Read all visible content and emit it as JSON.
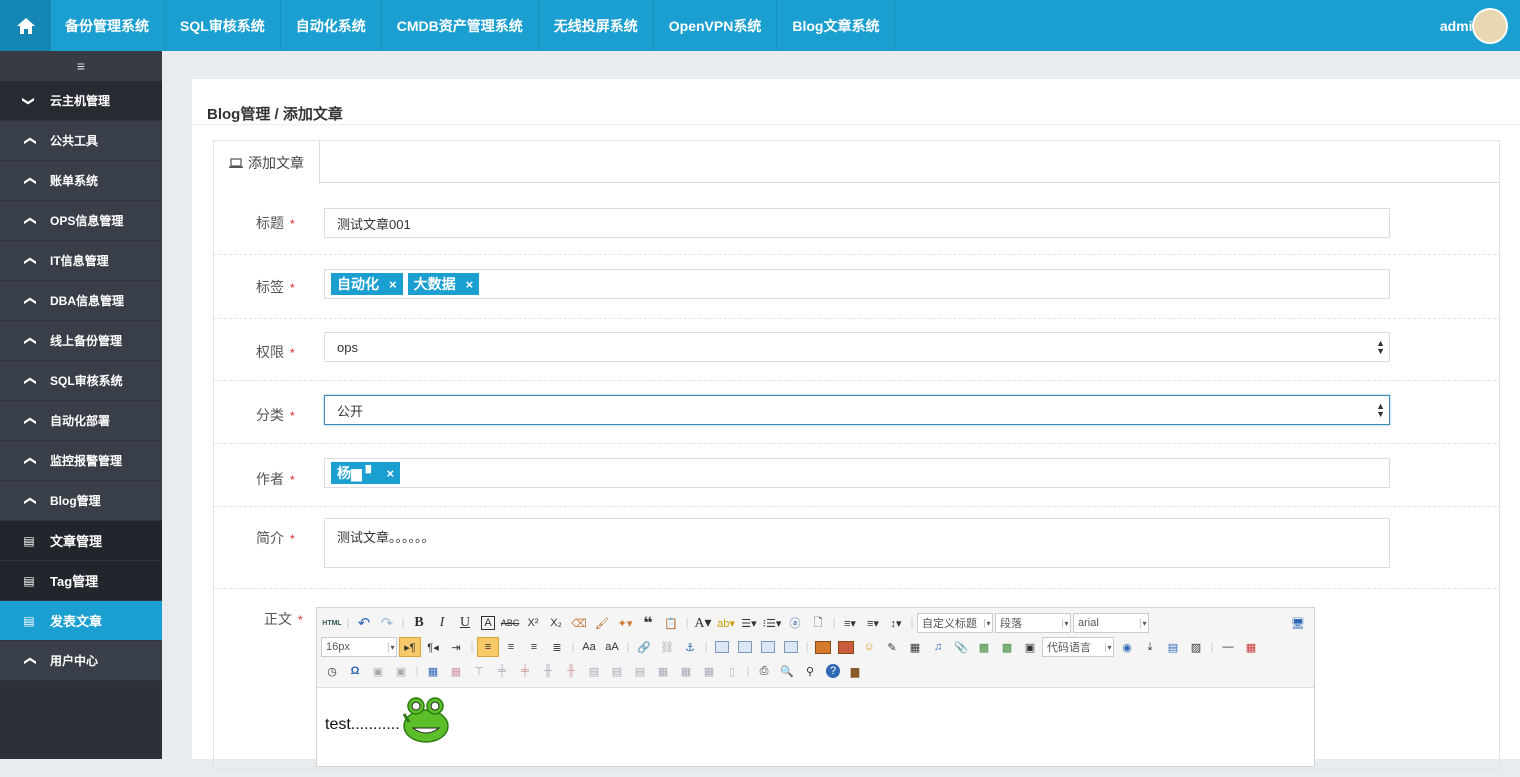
{
  "topnav": {
    "items": [
      "备份管理系统",
      "SQL审核系统",
      "自动化系统",
      "CMDB资产管理系统",
      "无线投屏系统",
      "OpenVPN系统",
      "Blog文章系统"
    ],
    "user": "admin"
  },
  "sidebar": {
    "toggle": "≡",
    "items": [
      {
        "label": "云主机管理",
        "icon": "chevron-down-icon"
      },
      {
        "label": "公共工具",
        "icon": "chevron-up-icon"
      },
      {
        "label": "账单系统",
        "icon": "chevron-up-icon"
      },
      {
        "label": "OPS信息管理",
        "icon": "chevron-up-icon"
      },
      {
        "label": "IT信息管理",
        "icon": "chevron-up-icon"
      },
      {
        "label": "DBA信息管理",
        "icon": "chevron-up-icon"
      },
      {
        "label": "线上备份管理",
        "icon": "chevron-up-icon"
      },
      {
        "label": "SQL审核系统",
        "icon": "chevron-up-icon"
      },
      {
        "label": "自动化部署",
        "icon": "chevron-up-icon"
      },
      {
        "label": "监控报警管理",
        "icon": "chevron-up-icon"
      },
      {
        "label": "Blog管理",
        "icon": "chevron-up-icon"
      },
      {
        "label": "文章管理",
        "icon": "list-icon"
      },
      {
        "label": "Tag管理",
        "icon": "list-icon"
      },
      {
        "label": "发表文章",
        "icon": "list-icon"
      },
      {
        "label": "用户中心",
        "icon": "chevron-up-icon"
      }
    ]
  },
  "breadcrumb": "Blog管理 / 添加文章",
  "tab": "添加文章",
  "form": {
    "title_label": "标题",
    "title_value": "测试文章001",
    "tags_label": "标签",
    "tags": [
      "自动化",
      "大数据"
    ],
    "perm_label": "权限",
    "perm_value": "ops",
    "category_label": "分类",
    "category_value": "公开",
    "author_label": "作者",
    "author": "杨▆ ▘",
    "summary_label": "简介",
    "summary_value": "测试文章。。。。。。",
    "body_label": "正文",
    "required_mark": "*",
    "remove_mark": "×"
  },
  "editor": {
    "html_btn": "HTML",
    "custom_title": "自定义标题",
    "paragraph": "段落",
    "font": "arial",
    "size": "16px",
    "code_lang": "代码语言",
    "body_text": "test..........."
  },
  "colors": {
    "brand": "#1a9fd0",
    "sidebar": "#2c3038",
    "required": "#d9272e"
  }
}
